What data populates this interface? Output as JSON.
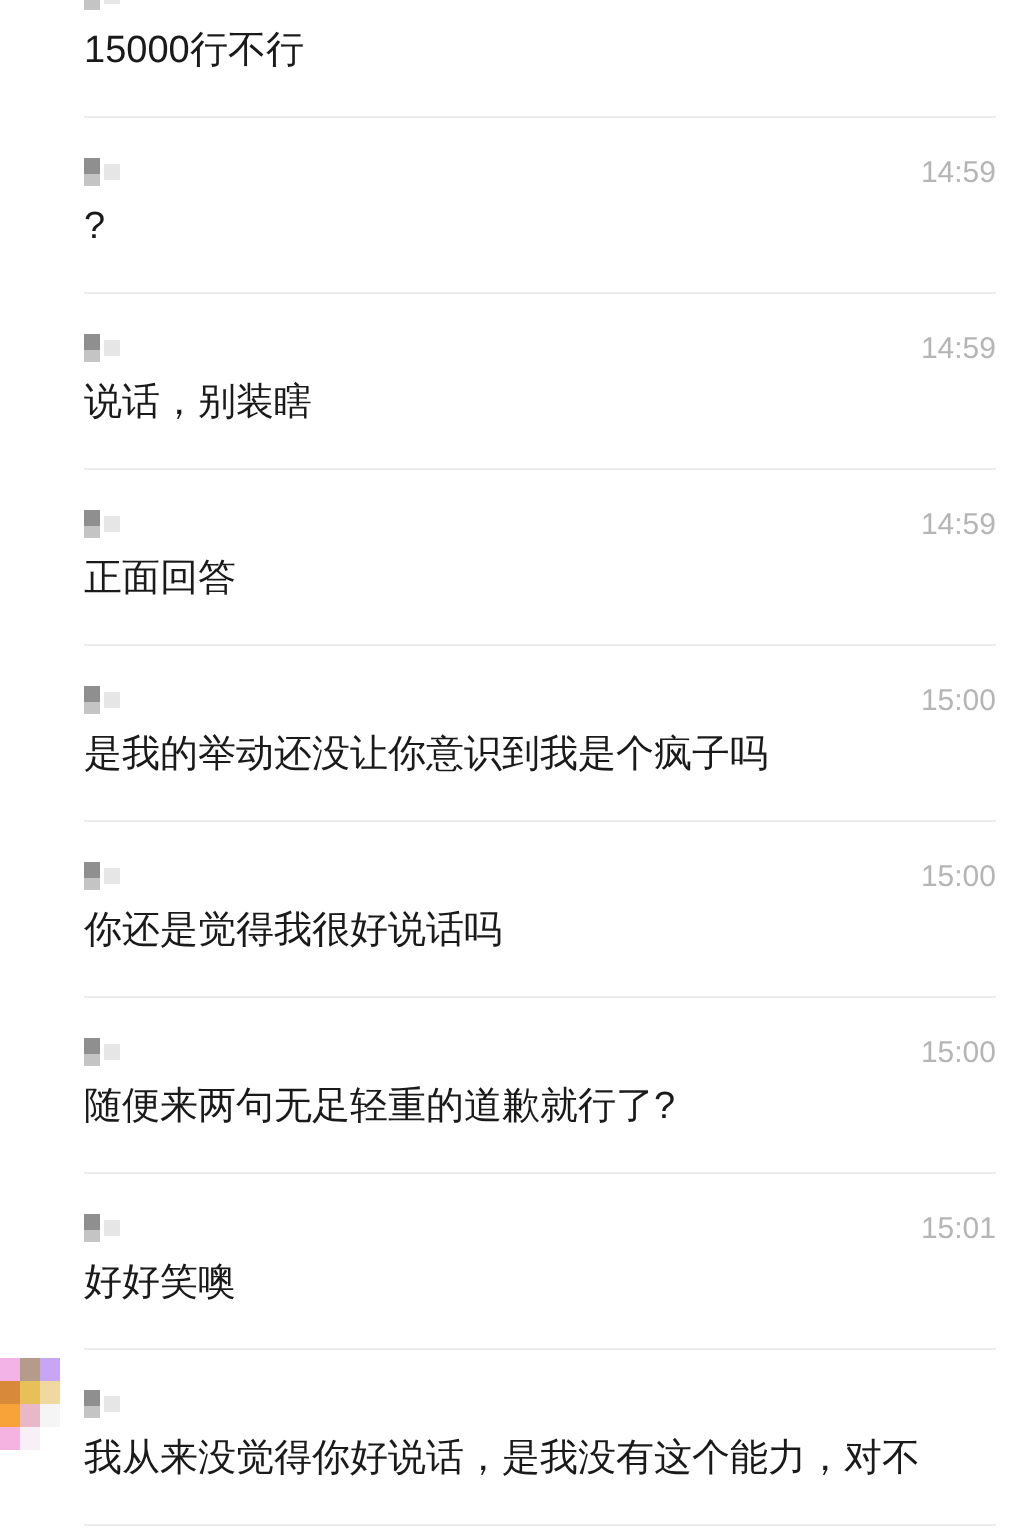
{
  "messages": [
    {
      "text": "15000行不行",
      "show_avatar": false
    },
    {
      "time": "14:59",
      "text": "?",
      "show_avatar": false
    },
    {
      "time": "14:59",
      "text": "说话，别装瞎",
      "show_avatar": false
    },
    {
      "time": "14:59",
      "text": "正面回答",
      "show_avatar": false
    },
    {
      "time": "15:00",
      "text": "是我的举动还没让你意识到我是个疯子吗",
      "show_avatar": false
    },
    {
      "time": "15:00",
      "text": "你还是觉得我很好说话吗",
      "show_avatar": false
    },
    {
      "time": "15:00",
      "text": "随便来两句无足轻重的道歉就行了?",
      "show_avatar": false
    },
    {
      "time": "15:01",
      "text": "好好笑噢",
      "show_avatar": false
    },
    {
      "text": "我从来没觉得你好说话，是我没有这个能力，对不",
      "show_avatar": true
    }
  ]
}
